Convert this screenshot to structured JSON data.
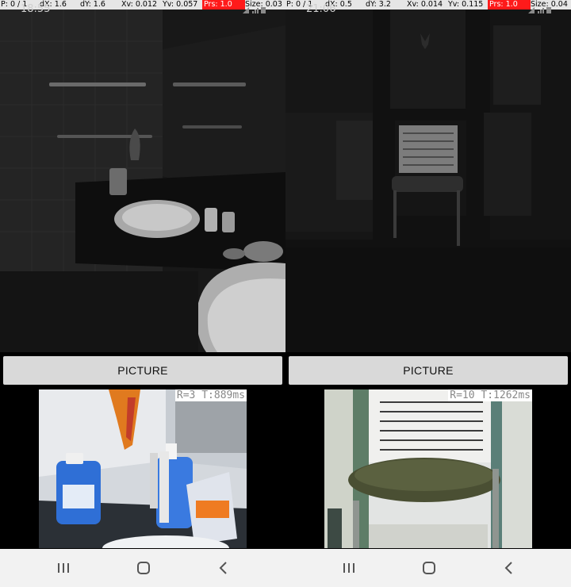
{
  "panels": [
    {
      "debug": {
        "p": "P: 0 / 1",
        "dx": "dX: 1.6",
        "dy": "dY: 1.6",
        "xv": "Xv: 0.012",
        "yv": "Yv: 0.057",
        "prs": "Prs: 1.0",
        "size": "Size: 0.03"
      },
      "time": "18:55",
      "button_label": "PICTURE",
      "result": "R=3 T:889ms"
    },
    {
      "debug": {
        "p": "P: 0 / 1",
        "dx": "dX: 0.5",
        "dy": "dY: 3.2",
        "xv": "Xv: 0.014",
        "yv": "Yv: 0.115",
        "prs": "Prs: 1.0",
        "size": "Size: 0.04"
      },
      "time": "21:06",
      "button_label": "PICTURE",
      "result": "R=10 T:1262ms"
    }
  ],
  "colors": {
    "debug_bar": "#e6e6e6",
    "pressure_bg": "#ff1a1a",
    "button": "#d9d9d9",
    "navbar": "#f2f2f2"
  },
  "icons": [
    "status-icons",
    "recent-apps-icon",
    "home-icon",
    "back-icon"
  ]
}
